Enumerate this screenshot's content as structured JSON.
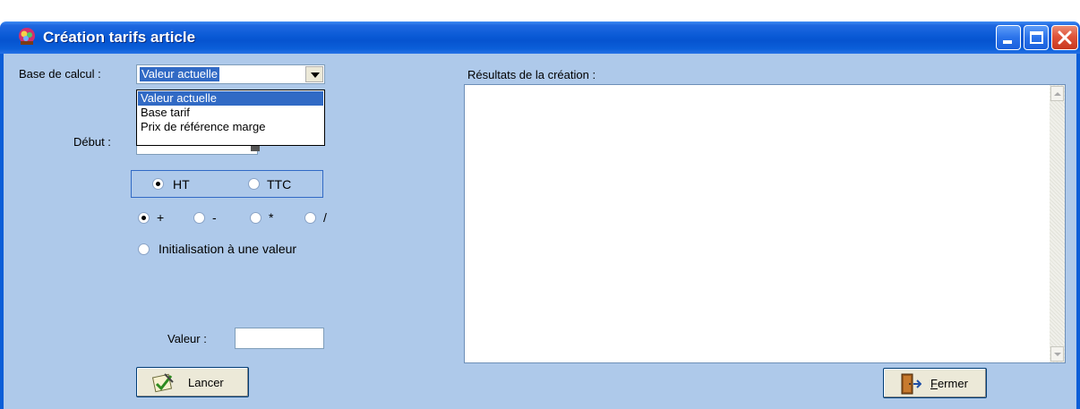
{
  "window": {
    "title": "Création tarifs article"
  },
  "form": {
    "base_calcul_label": "Base de calcul :",
    "base_calcul_value": "Valeur actuelle",
    "base_calcul_options": [
      "Valeur actuelle",
      "Base tarif",
      "Prix de référence marge"
    ],
    "debut_label": "Début :",
    "tax_mode": {
      "ht_label": "HT",
      "ttc_label": "TTC",
      "selected": "HT"
    },
    "operations": {
      "plus": "+",
      "minus": "-",
      "times": "*",
      "divide": "/",
      "selected": "+"
    },
    "init_label": "Initialisation à une valeur",
    "valeur_label": "Valeur :",
    "valeur_value": "",
    "launch_label": "Lancer"
  },
  "results": {
    "label": "Résultats de la création :",
    "content": ""
  },
  "footer": {
    "close_label_first": "F",
    "close_label_rest": "ermer"
  },
  "colors": {
    "client_bg": "#aec9ea",
    "titlebar": "#0654d0",
    "selection": "#316ac5"
  },
  "icons": {
    "app": "app-icon",
    "launch": "pen-check-icon",
    "close": "door-exit-icon"
  }
}
